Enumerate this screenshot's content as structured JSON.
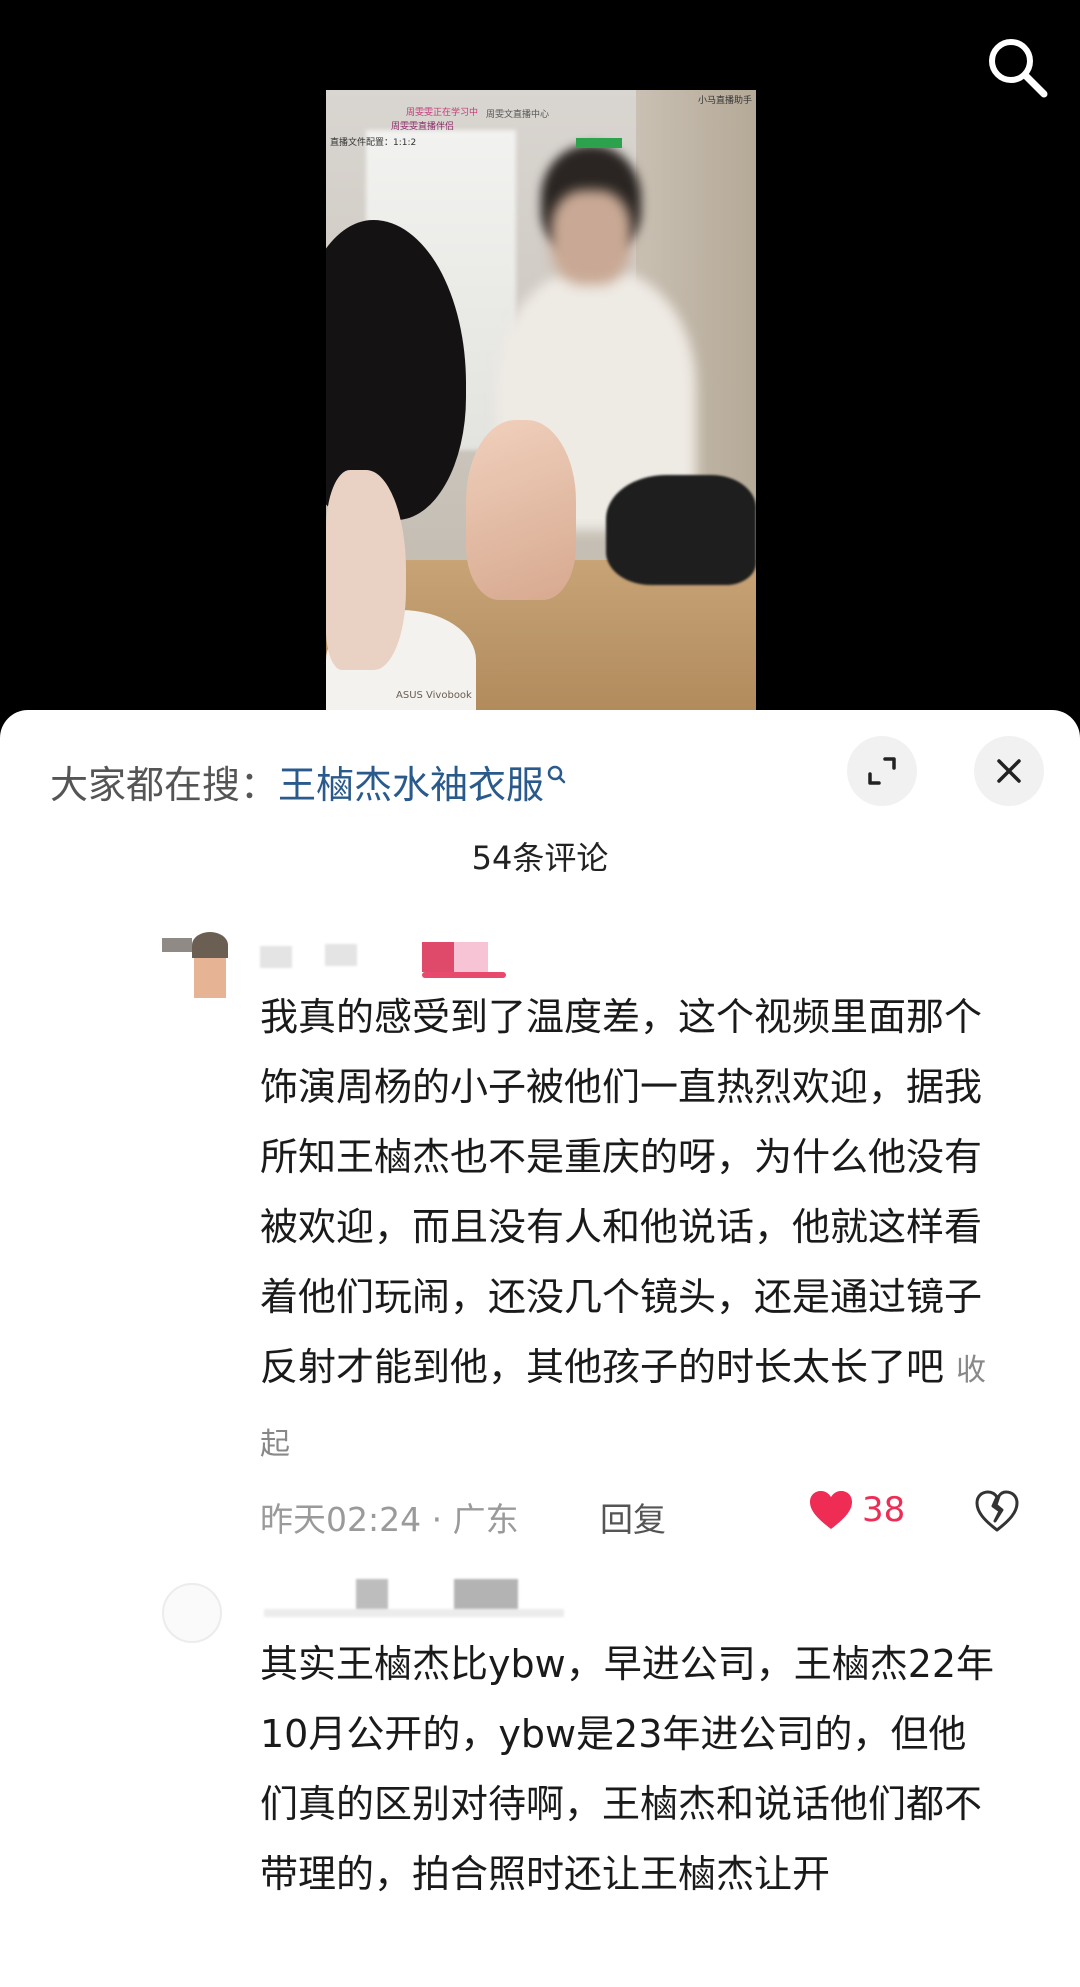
{
  "video": {
    "overlay_texts": [
      "周雯雯正在学习中",
      "周雯雯直播伴侣",
      "直播文件配置：1:1:2",
      "周雯文直播中心",
      "小马直播助手"
    ],
    "laptop_label": "ASUS Vivobook"
  },
  "sheet": {
    "search_prefix": "大家都在搜：",
    "search_term": "王樐杰水袖衣服",
    "comment_count": "54条评论"
  },
  "comments": [
    {
      "text": "我真的感受到了温度差，这个视频里面那个饰演周杨的小子被他们一直热烈欢迎，据我所知王樐杰也不是重庆的呀，为什么他没有被欢迎，而且没有人和他说话，他就这样看着他们玩闹，还没几个镜头，还是通过镜子反射才能到他，其他孩子的时长太长了吧",
      "collapse_label": "收起",
      "time_location": "昨天02:24 · 广东",
      "reply_label": "回复",
      "like_count": "38",
      "liked": true
    },
    {
      "text": "其实王樐杰比ybw，早进公司，王樐杰22年10月公开的，ybw是23年进公司的，但他们真的区别对待啊，王樐杰和说话他们都不带理的，拍合照时还让王樐杰让开"
    }
  ],
  "colors": {
    "accent_like": "#ee2c54",
    "search_term": "#2a5a8c"
  },
  "icons": [
    "search-icon",
    "magnifier-small-icon",
    "expand-icon",
    "close-icon",
    "heart-icon",
    "broken-heart-icon"
  ]
}
